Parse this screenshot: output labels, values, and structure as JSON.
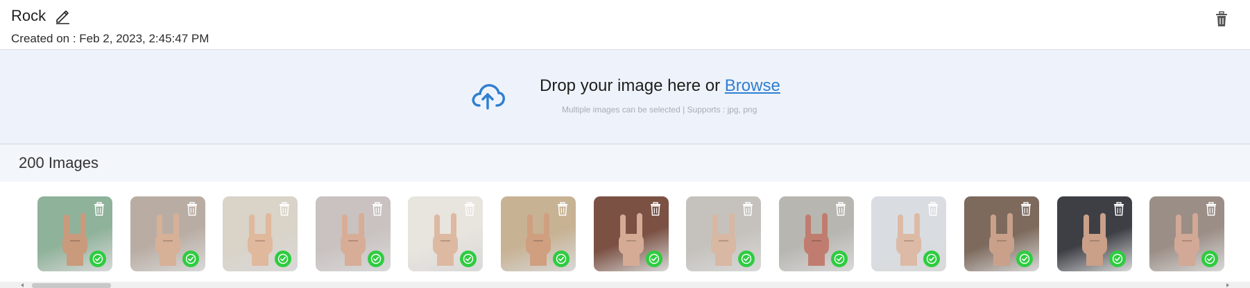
{
  "header": {
    "title": "Rock",
    "created_label": "Created on : Feb 2, 2023, 2:45:47 PM"
  },
  "upload": {
    "drop_text": "Drop your image here or ",
    "browse_label": "Browse",
    "hint": "Multiple images can be selected | Supports : jpg, png"
  },
  "images": {
    "count_label": "200 Images",
    "thumbnails": [
      {
        "bg": "#8fb29a",
        "skin": "#c99a7c",
        "status": "uploaded"
      },
      {
        "bg": "#b9ada3",
        "skin": "#d6b097",
        "status": "uploaded"
      },
      {
        "bg": "#d9d3c8",
        "skin": "#e0b89c",
        "status": "uploaded"
      },
      {
        "bg": "#c9c2c0",
        "skin": "#d7ad97",
        "status": "uploaded"
      },
      {
        "bg": "#e8e4de",
        "skin": "#ddb9a2",
        "status": "uploaded"
      },
      {
        "bg": "#c7b294",
        "skin": "#cf9f80",
        "status": "uploaded"
      },
      {
        "bg": "#7b5143",
        "skin": "#d6ab95",
        "status": "uploaded"
      },
      {
        "bg": "#c5c2bd",
        "skin": "#d8b7a3",
        "status": "uploaded"
      },
      {
        "bg": "#b8b6b1",
        "skin": "#c07d6f",
        "status": "uploaded"
      },
      {
        "bg": "#d9dde2",
        "skin": "#dcbaa5",
        "status": "uploaded"
      },
      {
        "bg": "#7d6a5d",
        "skin": "#c9a18a",
        "status": "uploaded"
      },
      {
        "bg": "#3d3f45",
        "skin": "#caa089",
        "status": "uploaded"
      },
      {
        "bg": "#9b8e86",
        "skin": "#d2a896",
        "status": "uploaded"
      }
    ]
  },
  "colors": {
    "accent": "#2f7fd1",
    "success": "#2ecc40",
    "upload_bg": "#eef3fb"
  },
  "icons": {
    "edit": "pencil-icon",
    "delete": "trash-icon",
    "upload": "cloud-upload-icon",
    "status": "check-circle-icon"
  }
}
